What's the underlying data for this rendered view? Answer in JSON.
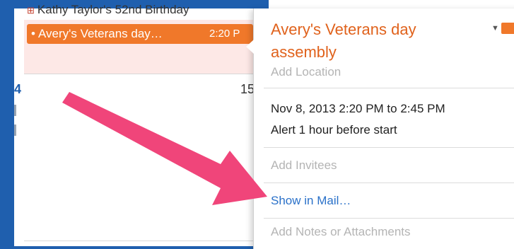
{
  "calendar": {
    "birthday_event": "Kathy Taylor's 52nd Birthday",
    "selected_event": {
      "label": "Avery's Veterans day…",
      "time": "2:20 P",
      "color": "#f0782a"
    },
    "day_number": "15"
  },
  "popover": {
    "title": "Avery's Veterans day assembly",
    "location_placeholder": "Add Location",
    "date_time": "Nov 8, 2013  2:20 PM to 2:45 PM",
    "alert": "Alert 1 hour before start",
    "invitees_placeholder": "Add Invitees",
    "show_in_mail": "Show in Mail…",
    "notes_placeholder": "Add Notes or Attachments",
    "calendar_color": "#f0782a"
  },
  "annotation": {
    "arrow_color": "#f0457a"
  }
}
